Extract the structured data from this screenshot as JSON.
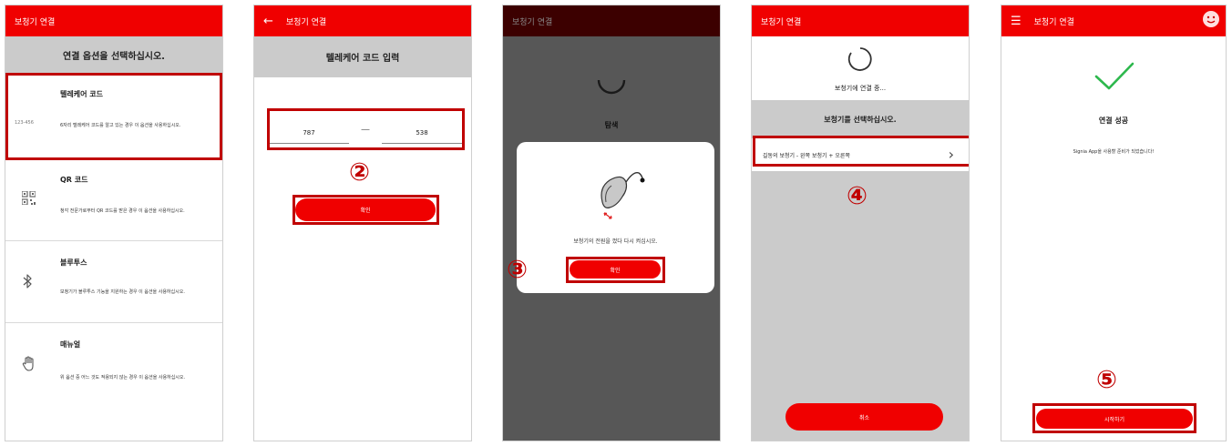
{
  "p1": {
    "title": "보청기 연결",
    "heading": "연결 옵션을 선택하십시오.",
    "options": [
      {
        "title": "텔레케어 코드",
        "desc": "6자리 텔레케어 코드를 알고 있는 경우 이 옵션을 사용하십시오.",
        "sample": "123-456"
      },
      {
        "title": "QR 코드",
        "desc": "청각 전문가로부터 QR 코드를 받은 경우 이 옵션을 사용하십시오."
      },
      {
        "title": "블루투스",
        "desc": "보청기가 블루투스 기능을 지원하는 경우 이 옵션을 사용하십시오."
      },
      {
        "title": "매뉴얼",
        "desc": "위 옵션 중 어느 것도 적용되지 않는 경우 이 옵션을 사용하십시오."
      }
    ]
  },
  "p2": {
    "title": "보청기 연결",
    "heading": "텔레케어 코드 입력",
    "code_left": "787",
    "code_dash": "—",
    "code_right": "538",
    "button": "확인",
    "step": "②"
  },
  "p3": {
    "title": "보청기 연결",
    "search": "탐색",
    "msg": "보청기의 전원을 껐다 다시 켜십시오.",
    "button": "확인",
    "step": "③"
  },
  "p4": {
    "title": "보청기 연결",
    "connecting": "보청기에 연결 중...",
    "heading": "보청기를 선택하십시오.",
    "device": "길동의 보청기 - 왼쪽 보청기 + 오른쪽",
    "cancel": "취소",
    "step": "④"
  },
  "p5": {
    "title": "보청기 연결",
    "heading": "연결 성공",
    "msg": "Signia App을 사용할 준비가 되었습니다!",
    "button": "시작하기",
    "step": "⑤"
  },
  "colors": {
    "accent": "#f00000",
    "highlight": "#c00000",
    "gray": "#cbcbcb"
  }
}
